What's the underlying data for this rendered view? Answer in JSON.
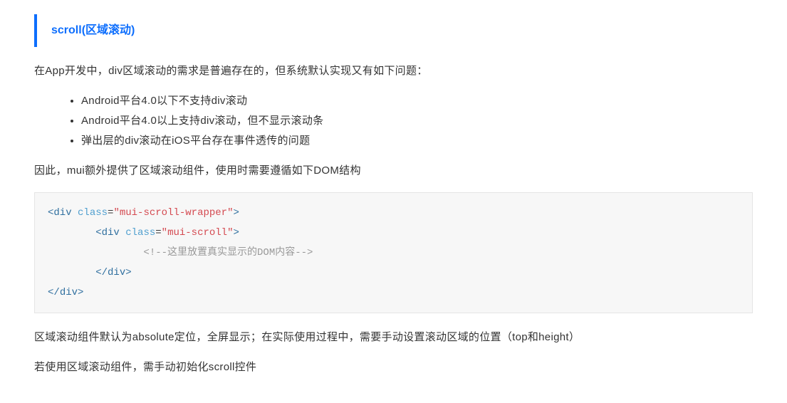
{
  "heading": {
    "title": "scroll(区域滚动)"
  },
  "para1": "在App开发中，div区域滚动的需求是普遍存在的，但系统默认实现又有如下问题：",
  "bullets": [
    "Android平台4.0以下不支持div滚动",
    "Android平台4.0以上支持div滚动，但不显示滚动条",
    "弹出层的div滚动在iOS平台存在事件透传的问题"
  ],
  "para2": "因此，mui额外提供了区域滚动组件，使用时需要遵循如下DOM结构",
  "code": {
    "line1_open_bracket": "<",
    "line1_tag": "div",
    "line1_attrname": "class",
    "line1_attrvalue": "\"mui-scroll-wrapper\"",
    "line1_close": ">",
    "line2_open_bracket": "<",
    "line2_tag": "div",
    "line2_attrname": "class",
    "line2_attrvalue": "\"mui-scroll\"",
    "line2_close": ">",
    "line3_comment": "<!--这里放置真实显示的DOM内容-->",
    "line4_open": "</",
    "line4_tag": "div",
    "line4_close": ">",
    "line5_open": "</",
    "line5_tag": "div",
    "line5_close": ">"
  },
  "para3": "区域滚动组件默认为absolute定位，全屏显示；在实际使用过程中，需要手动设置滚动区域的位置（top和height）",
  "para4": "若使用区域滚动组件，需手动初始化scroll控件"
}
